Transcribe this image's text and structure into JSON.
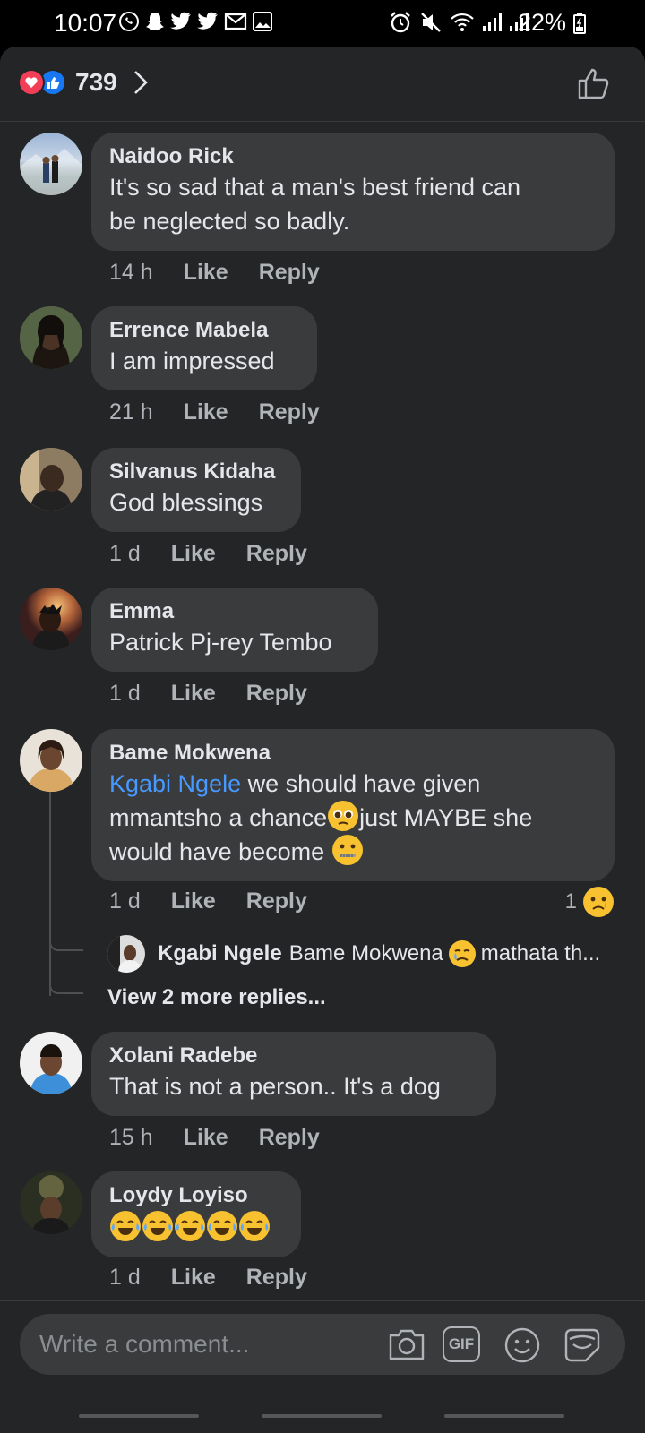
{
  "status_bar": {
    "time": "10:07",
    "battery": "22%",
    "icons_left": [
      "whatsapp-icon",
      "snapchat-icon",
      "twitter-icon",
      "twitter-icon",
      "gmail-icon",
      "gallery-icon"
    ],
    "icons_right": [
      "alarm-icon",
      "mute-icon",
      "wifi-icon",
      "signal-icon",
      "signal-icon"
    ]
  },
  "header": {
    "reaction_count": "739",
    "reactions": [
      "love",
      "like"
    ]
  },
  "comments": [
    {
      "name": "Naidoo Rick",
      "text_lines": [
        "It's so sad that a man's best friend can",
        "be neglected so badly."
      ],
      "time": "14 h",
      "like": "Like",
      "reply": "Reply"
    },
    {
      "name": "Errence Mabela",
      "text_lines": [
        "I am impressed"
      ],
      "time": "21 h",
      "like": "Like",
      "reply": "Reply"
    },
    {
      "name": "Silvanus Kidaha",
      "text_lines": [
        "God blessings"
      ],
      "time": "1 d",
      "like": "Like",
      "reply": "Reply"
    },
    {
      "name": "Emma",
      "text_lines": [
        "Patrick Pj-rey Tembo"
      ],
      "time": "1 d",
      "like": "Like",
      "reply": "Reply"
    },
    {
      "name": "Bame Mokwena",
      "mention": "Kgabi Ngele",
      "text_line1_rest": " we should have given",
      "text_line2": "mmantsho a chance",
      "text_line2_rest": "just MAYBE she",
      "text_line3": "would have become ",
      "time": "1 d",
      "like": "Like",
      "reply": "Reply",
      "reaction_count": "1",
      "reply_preview": {
        "name": "Kgabi Ngele",
        "text": "Bame Mokwena",
        "text_rest": " mathata th..."
      },
      "view_more": "View 2 more replies..."
    },
    {
      "name": "Xolani Radebe",
      "text_lines": [
        "That is not a person.. It's a dog"
      ],
      "time": "15 h",
      "like": "Like",
      "reply": "Reply"
    },
    {
      "name": "Loydy Loyiso",
      "emoji_count": 5,
      "time": "1 d",
      "like": "Like",
      "reply": "Reply"
    }
  ],
  "composer": {
    "placeholder": "Write a comment...",
    "gif_label": "GIF"
  },
  "colors": {
    "background": "#242526",
    "bubble": "#3a3b3c",
    "mention": "#4599ff",
    "like_blue": "#1877f2",
    "love_red": "#f33e58"
  }
}
